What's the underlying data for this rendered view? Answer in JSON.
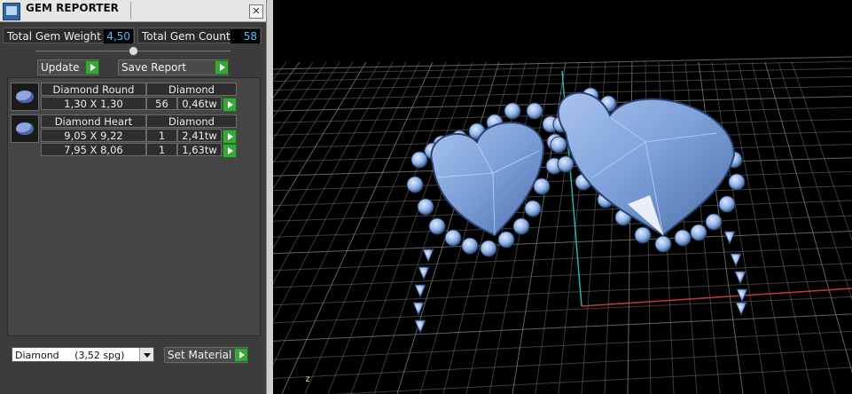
{
  "window": {
    "title": "GEM REPORTER",
    "close_icon": "close-icon"
  },
  "stats": {
    "weight_label": "Total Gem Weight",
    "weight_value": "4,50",
    "count_label": "Total Gem Count",
    "count_value": "58"
  },
  "toolbar": {
    "update_label": "Update",
    "save_label": "Save Report"
  },
  "gems": [
    {
      "icon": "round-gem-icon",
      "name": "Diamond Round",
      "material": "Diamond",
      "rows": [
        {
          "size": "1,30 X 1,30",
          "count": "56",
          "weight": "0,46tw"
        }
      ]
    },
    {
      "icon": "heart-gem-icon",
      "name": "Diamond Heart",
      "material": "Diamond",
      "rows": [
        {
          "size": "9,05 X 9,22",
          "count": "1",
          "weight": "2,41tw"
        },
        {
          "size": "7,95 X 8,06",
          "count": "1",
          "weight": "1,63tw"
        }
      ]
    }
  ],
  "material": {
    "selected": "Diamond     (3,52 spg)",
    "set_label": "Set Material"
  },
  "viewport": {
    "axis_label": "z",
    "gem_color": "#8fb2e6",
    "grid_color": "#6e6e6e"
  }
}
